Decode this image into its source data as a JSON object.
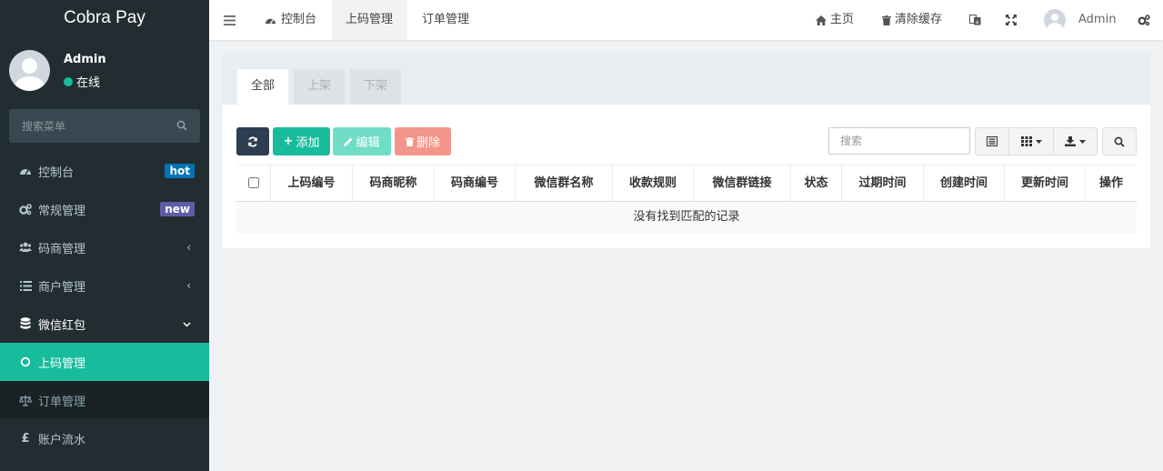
{
  "app": {
    "title": "Cobra Pay"
  },
  "user": {
    "name": "Admin",
    "status": "在线"
  },
  "sidebar": {
    "search_placeholder": "搜索菜单",
    "items": [
      {
        "label": "控制台",
        "badge": "hot",
        "badge_color": "#0073b7"
      },
      {
        "label": "常规管理",
        "badge": "new",
        "badge_color": "#605ca8"
      },
      {
        "label": "码商管理"
      },
      {
        "label": "商户管理"
      },
      {
        "label": "微信红包"
      },
      {
        "label": "上码管理"
      },
      {
        "label": "订单管理"
      },
      {
        "label": "账户流水"
      }
    ]
  },
  "topbar": {
    "tabs": [
      {
        "label": "控制台"
      },
      {
        "label": "上码管理"
      },
      {
        "label": "订单管理"
      }
    ],
    "home": "主页",
    "clear_cache": "清除缓存",
    "admin": "Admin"
  },
  "content": {
    "tabs": [
      {
        "label": "全部"
      },
      {
        "label": "上架"
      },
      {
        "label": "下架"
      }
    ],
    "buttons": {
      "add": "添加",
      "edit": "编辑",
      "delete": "删除"
    },
    "search_placeholder": "搜索",
    "columns": [
      "上码编号",
      "码商昵称",
      "码商编号",
      "微信群名称",
      "收款规则",
      "微信群链接",
      "状态",
      "过期时间",
      "创建时间",
      "更新时间",
      "操作"
    ],
    "empty_text": "没有找到匹配的记录"
  },
  "colors": {
    "sidebar_bg": "#222d32",
    "accent": "#18bc9c",
    "edit_button": "#71ddc7",
    "delete_button": "#f3958a",
    "refresh_button": "#2c3e50"
  }
}
